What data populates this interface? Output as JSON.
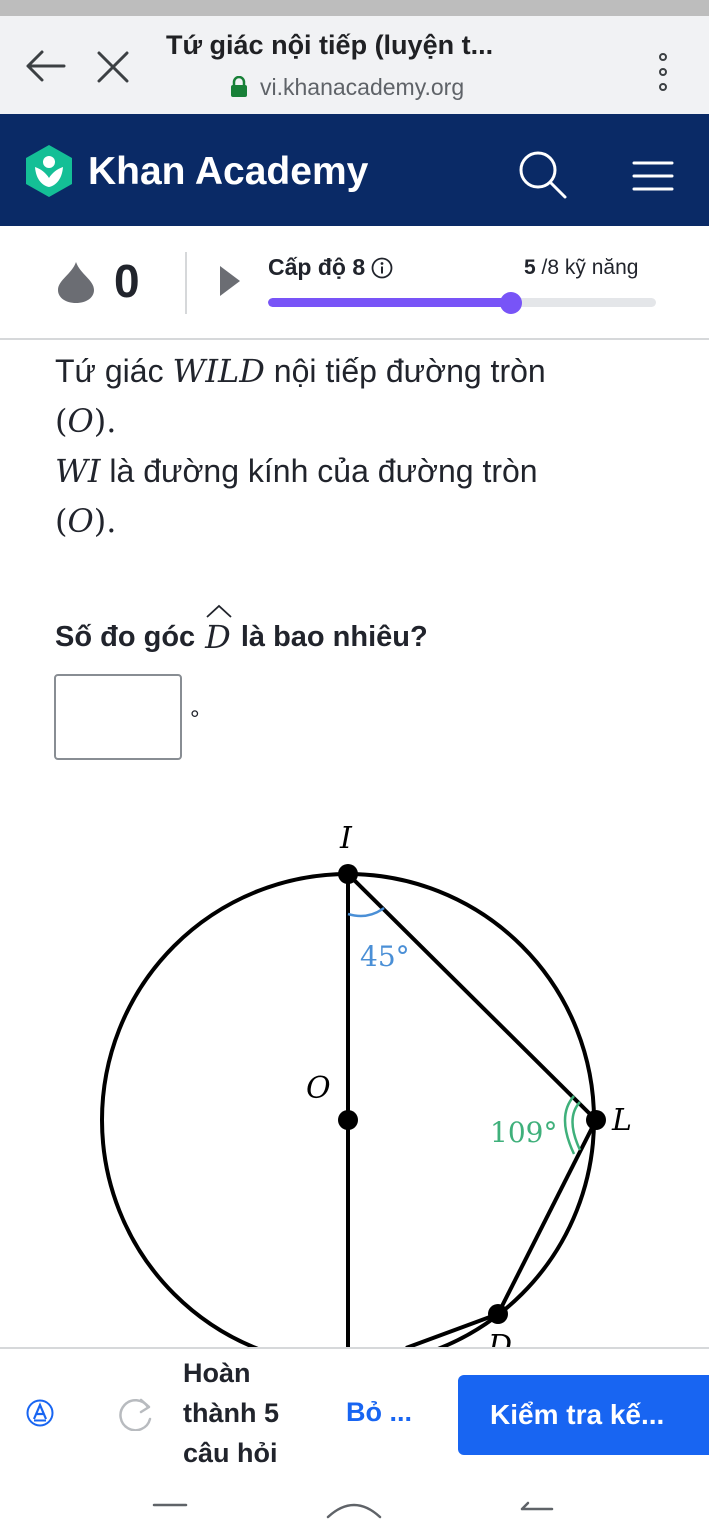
{
  "browser": {
    "title": "Tứ giác nội tiếp (luyện t...",
    "url": "vi.khanacademy.org",
    "icons": [
      "back-arrow-icon",
      "close-icon",
      "lock-icon",
      "kebab-menu-icon"
    ]
  },
  "header": {
    "brand": "Khan Academy",
    "icons": [
      "khan-logo-icon",
      "search-icon",
      "hamburger-menu-icon"
    ],
    "colors": {
      "background": "#0a2a66",
      "logo": "#14bf96"
    }
  },
  "progress": {
    "streak": "0",
    "level_label": "Cấp độ 8",
    "skills_done": "5",
    "skills_total_label": "/8 kỹ năng",
    "fraction": 0.625,
    "color": "#7854f7"
  },
  "question": {
    "line1_pre": "Tứ giác ",
    "quad": "WILD",
    "line1_post": " nội tiếp đường tròn",
    "circle": "(O).",
    "line2_segment": "WI",
    "line2_post": " là đường kính của đường tròn",
    "circle2": "(O).",
    "prompt_pre": "Số đo góc",
    "prompt_angle": "D",
    "prompt_post": "là bao nhiêu?",
    "answer_value": "",
    "unit": "°"
  },
  "figure": {
    "labels": {
      "I": "I",
      "O": "O",
      "L": "L",
      "D": "D"
    },
    "angle_I": "45°",
    "angle_L": "109°",
    "colors": {
      "angle_I": "#4a8fd6",
      "angle_L": "#3fb07b"
    }
  },
  "footer": {
    "done_label": "Hoàn thành 5 câu hỏi",
    "skip_label": "Bỏ ...",
    "check_label": "Kiểm tra kế...",
    "icons": [
      "accessibility-icon",
      "redo-icon"
    ],
    "colors": {
      "primary": "#1865f2"
    }
  }
}
